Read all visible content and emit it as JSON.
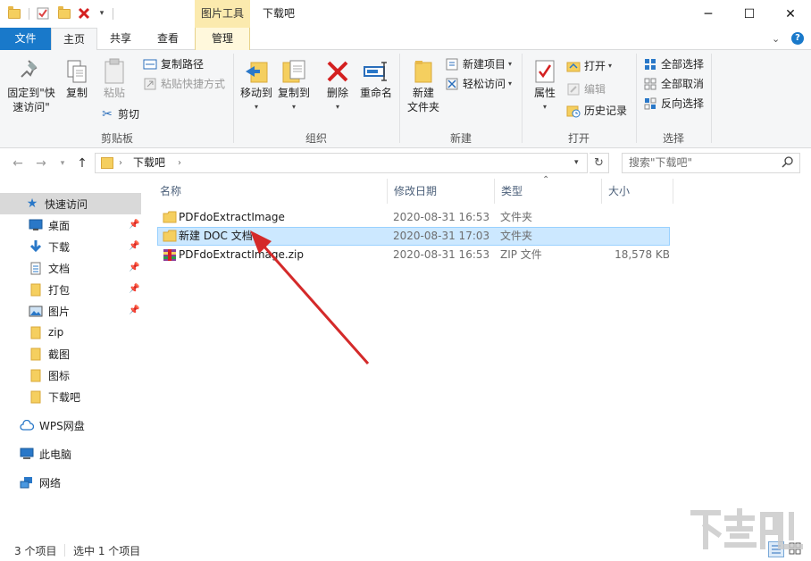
{
  "window": {
    "title": "下载吧",
    "tool_tab_header": "图片工具",
    "minimize": "─",
    "maximize": "☐",
    "close": "✕"
  },
  "tabs": {
    "file": "文件",
    "home": "主页",
    "share": "共享",
    "view": "查看",
    "manage": "管理"
  },
  "ribbon": {
    "clipboard": {
      "label": "剪贴板",
      "pin_quick_access": [
        "固定到\"快",
        "速访问\""
      ],
      "copy": "复制",
      "paste": "粘贴",
      "copy_path": "复制路径",
      "paste_shortcut": "粘贴快捷方式",
      "cut": "剪切"
    },
    "organize": {
      "label": "组织",
      "move_to": "移动到",
      "copy_to": "复制到",
      "delete": "删除",
      "rename": "重命名"
    },
    "new": {
      "label": "新建",
      "new_folder": [
        "新建",
        "文件夹"
      ],
      "new_item": "新建项目",
      "easy_access": "轻松访问"
    },
    "open": {
      "label": "打开",
      "properties": "属性",
      "open": "打开",
      "edit": "编辑",
      "history": "历史记录"
    },
    "select": {
      "label": "选择",
      "select_all": "全部选择",
      "select_none": "全部取消",
      "invert": "反向选择"
    }
  },
  "address": {
    "path": "下载吧",
    "search_placeholder": "搜索\"下载吧\""
  },
  "nav": {
    "quick_access": "快速访问",
    "items": [
      {
        "label": "桌面",
        "pinned": true,
        "icon": "desktop-icon"
      },
      {
        "label": "下载",
        "pinned": true,
        "icon": "download-icon"
      },
      {
        "label": "文档",
        "pinned": true,
        "icon": "document-icon"
      },
      {
        "label": "打包",
        "pinned": true,
        "icon": "folder-icon"
      },
      {
        "label": "图片",
        "pinned": true,
        "icon": "pictures-icon"
      },
      {
        "label": "zip",
        "pinned": false,
        "icon": "folder-icon"
      },
      {
        "label": "截图",
        "pinned": false,
        "icon": "folder-icon"
      },
      {
        "label": "图标",
        "pinned": false,
        "icon": "folder-icon"
      },
      {
        "label": "下载吧",
        "pinned": false,
        "icon": "folder-icon"
      }
    ],
    "wps": "WPS网盘",
    "this_pc": "此电脑",
    "network": "网络"
  },
  "columns": {
    "name": "名称",
    "modified": "修改日期",
    "type": "类型",
    "size": "大小"
  },
  "files": [
    {
      "name": "PDFdoExtractImage",
      "modified": "2020-08-31 16:53",
      "type": "文件夹",
      "size": "",
      "kind": "folder"
    },
    {
      "name": "新建 DOC 文档",
      "modified": "2020-08-31 17:03",
      "type": "文件夹",
      "size": "",
      "kind": "folder"
    },
    {
      "name": "PDFdoExtractImage.zip",
      "modified": "2020-08-31 16:53",
      "type": "ZIP 文件",
      "size": "18,578 KB",
      "kind": "zip"
    }
  ],
  "status": {
    "count": "3 个项目",
    "selected": "选中 1 个项目"
  },
  "colors": {
    "accent": "#1979ca",
    "selection": "#cce8ff",
    "tool_tab": "#fbeaae",
    "arrow": "#d42a2a"
  }
}
